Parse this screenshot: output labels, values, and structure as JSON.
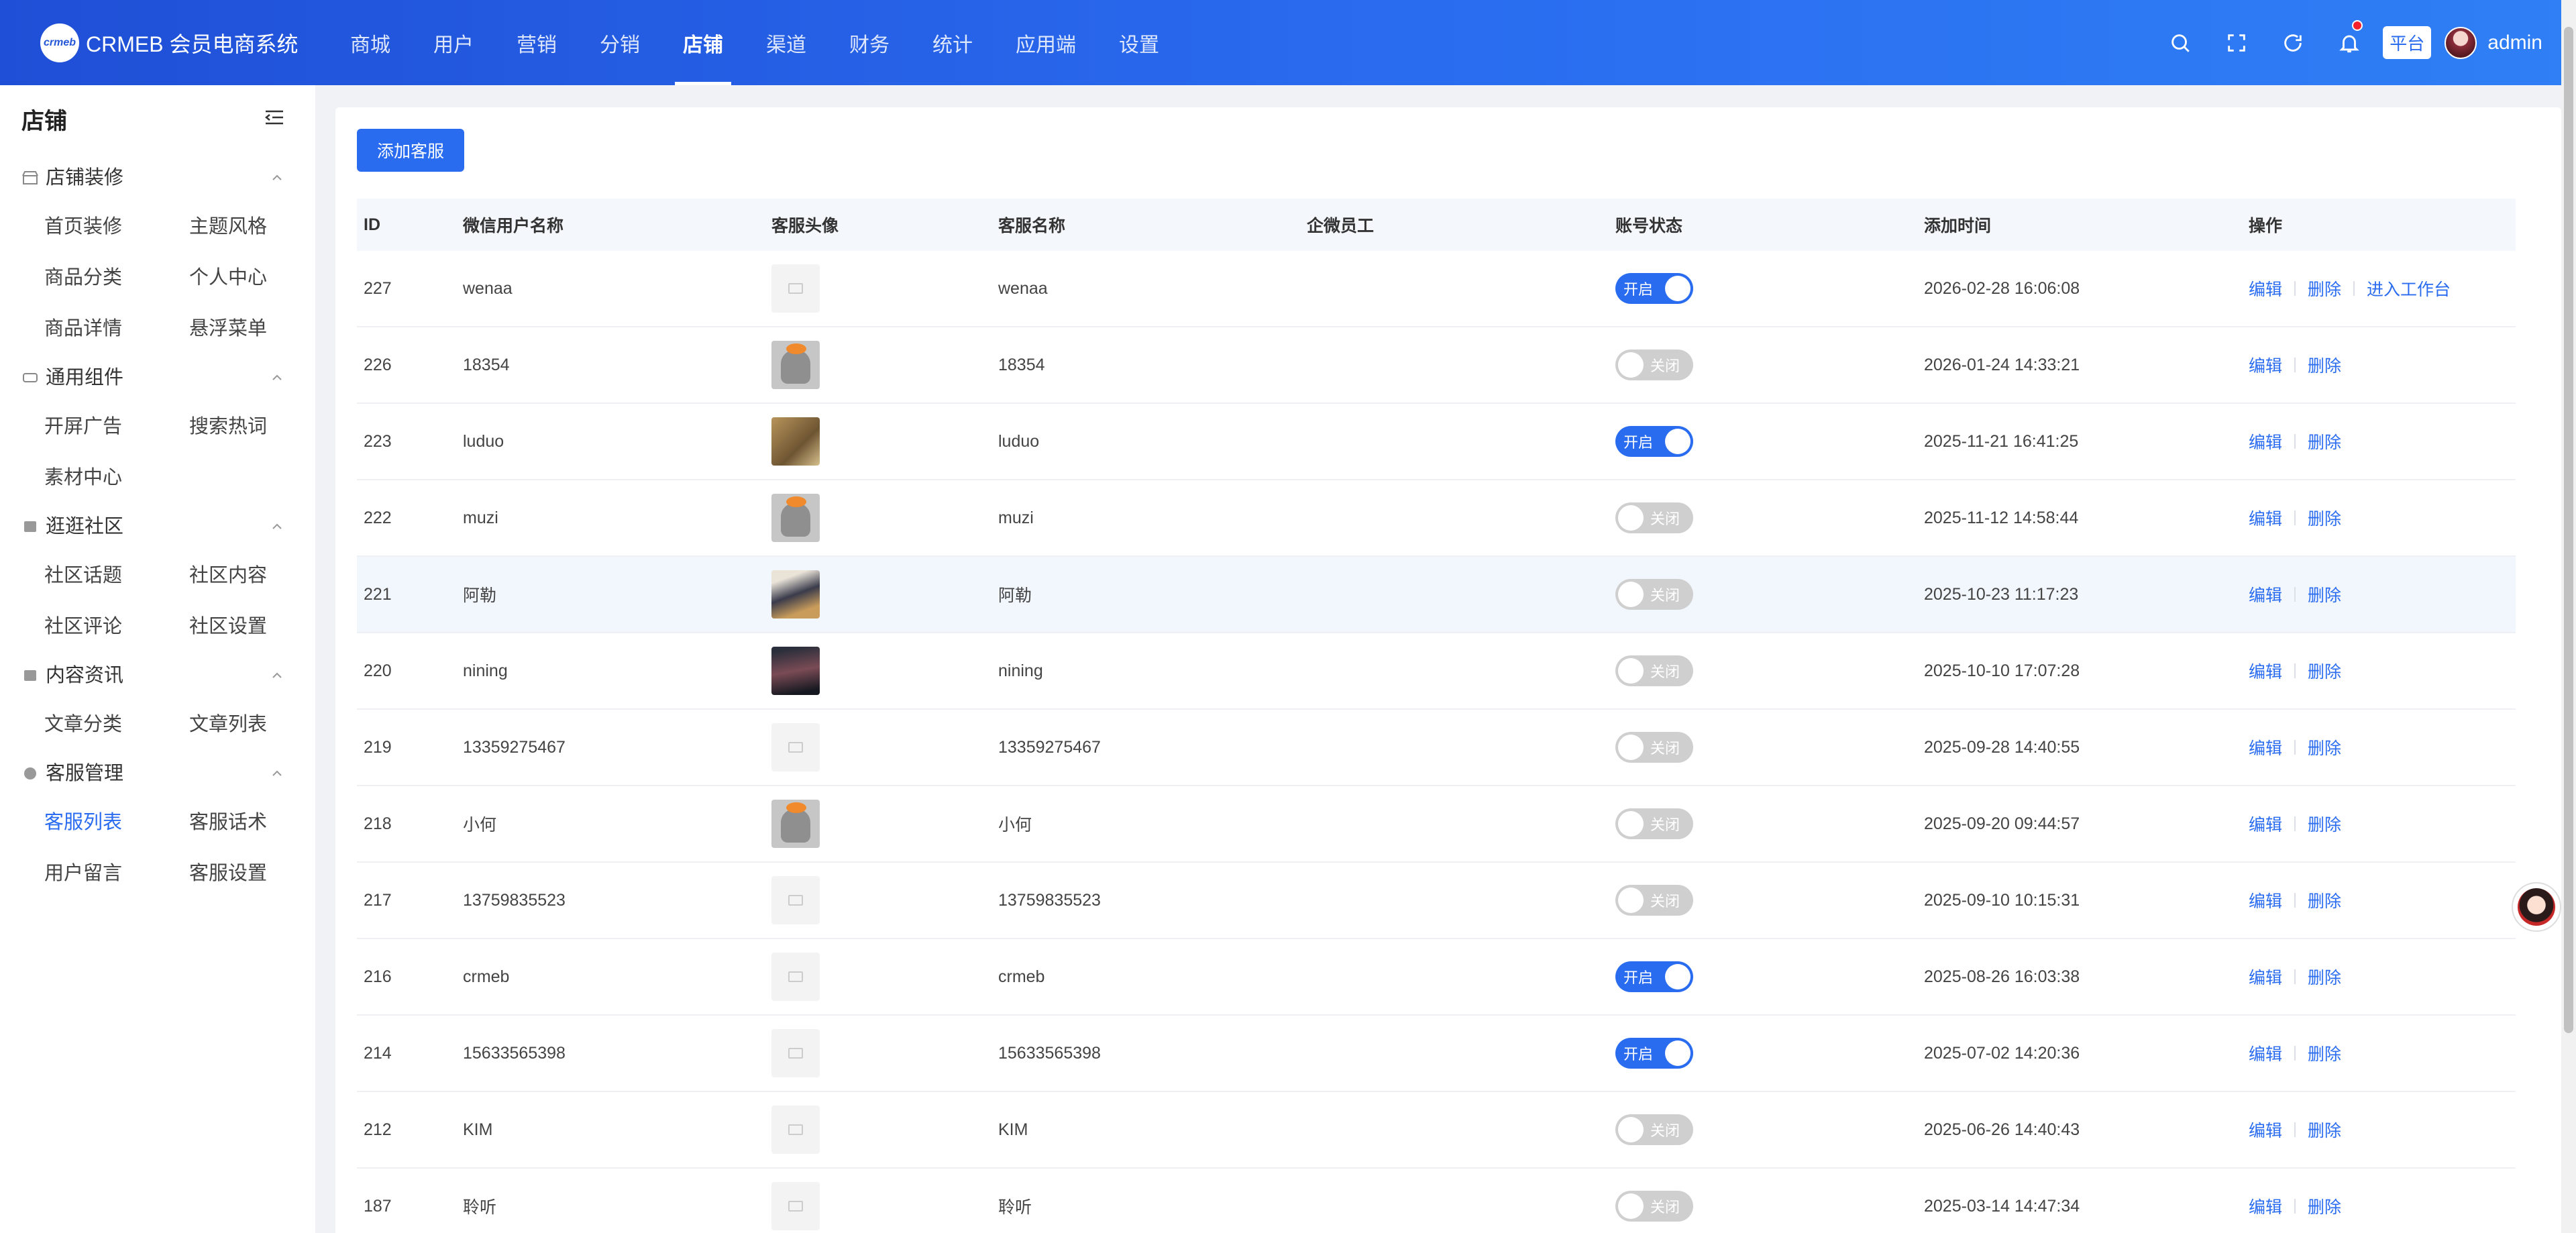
{
  "app": {
    "logo_mark": "crmeb",
    "title": "CRMEB 会员电商系统"
  },
  "topnav": [
    {
      "label": "商城",
      "active": false
    },
    {
      "label": "用户",
      "active": false
    },
    {
      "label": "营销",
      "active": false
    },
    {
      "label": "分销",
      "active": false
    },
    {
      "label": "店铺",
      "active": true
    },
    {
      "label": "渠道",
      "active": false
    },
    {
      "label": "财务",
      "active": false
    },
    {
      "label": "统计",
      "active": false
    },
    {
      "label": "应用端",
      "active": false
    },
    {
      "label": "设置",
      "active": false
    }
  ],
  "header_right": {
    "platform_tag": "平台",
    "username": "admin",
    "icons": [
      "search-icon",
      "fullscreen-icon",
      "refresh-icon",
      "bell-icon"
    ]
  },
  "sidebar": {
    "title": "店铺",
    "sections": [
      {
        "label": "店铺装修",
        "icon": "shop-icon",
        "items": [
          "首页装修",
          "主题风格",
          "商品分类",
          "个人中心",
          "商品详情",
          "悬浮菜单"
        ]
      },
      {
        "label": "通用组件",
        "icon": "component-icon",
        "items": [
          "开屏广告",
          "搜索热词",
          "素材中心"
        ]
      },
      {
        "label": "逛逛社区",
        "icon": "community-icon",
        "items": [
          "社区话题",
          "社区内容",
          "社区评论",
          "社区设置"
        ]
      },
      {
        "label": "内容资讯",
        "icon": "article-icon",
        "items": [
          "文章分类",
          "文章列表"
        ]
      },
      {
        "label": "客服管理",
        "icon": "service-icon",
        "items": [
          "客服列表",
          "客服话术",
          "用户留言",
          "客服设置"
        ]
      }
    ],
    "active_item": "客服列表"
  },
  "toolbar": {
    "add_label": "添加客服"
  },
  "table": {
    "headers": {
      "id": "ID",
      "nickname": "微信用户名称",
      "avatar": "客服头像",
      "name": "客服名称",
      "employee": "企微员工",
      "status": "账号状态",
      "time": "添加时间",
      "ops": "操作"
    },
    "status_on": "开启",
    "status_off": "关闭",
    "op_edit": "编辑",
    "op_delete": "删除",
    "op_workbench": "进入工作台",
    "rows": [
      {
        "id": "227",
        "nickname": "wenaa",
        "avatar": "default",
        "name": "wenaa",
        "employee": "",
        "status": "on",
        "time": "2026-02-28 16:06:08",
        "workbench": true
      },
      {
        "id": "226",
        "nickname": "18354",
        "avatar": "cat",
        "name": "18354",
        "employee": "",
        "status": "off",
        "time": "2026-01-24 14:33:21",
        "workbench": false
      },
      {
        "id": "223",
        "nickname": "luduo",
        "avatar": "brown",
        "name": "luduo",
        "employee": "",
        "status": "on",
        "time": "2025-11-21 16:41:25",
        "workbench": false
      },
      {
        "id": "222",
        "nickname": "muzi",
        "avatar": "cat",
        "name": "muzi",
        "employee": "",
        "status": "off",
        "time": "2025-11-12 14:58:44",
        "workbench": false
      },
      {
        "id": "221",
        "nickname": "阿勒",
        "avatar": "dark",
        "name": "阿勒",
        "employee": "",
        "status": "off",
        "time": "2025-10-23 11:17:23",
        "workbench": false
      },
      {
        "id": "220",
        "nickname": "nining",
        "avatar": "night",
        "name": "nining",
        "employee": "",
        "status": "off",
        "time": "2025-10-10 17:07:28",
        "workbench": false
      },
      {
        "id": "219",
        "nickname": "13359275467",
        "avatar": "default",
        "name": "13359275467",
        "employee": "",
        "status": "off",
        "time": "2025-09-28 14:40:55",
        "workbench": false
      },
      {
        "id": "218",
        "nickname": "小何",
        "avatar": "cat",
        "name": "小何",
        "employee": "",
        "status": "off",
        "time": "2025-09-20 09:44:57",
        "workbench": false
      },
      {
        "id": "217",
        "nickname": "13759835523",
        "avatar": "default",
        "name": "13759835523",
        "employee": "",
        "status": "off",
        "time": "2025-09-10 10:15:31",
        "workbench": false
      },
      {
        "id": "216",
        "nickname": "crmeb",
        "avatar": "default",
        "name": "crmeb",
        "employee": "",
        "status": "on",
        "time": "2025-08-26 16:03:38",
        "workbench": false
      },
      {
        "id": "214",
        "nickname": "15633565398",
        "avatar": "default",
        "name": "15633565398",
        "employee": "",
        "status": "on",
        "time": "2025-07-02 14:20:36",
        "workbench": false
      },
      {
        "id": "212",
        "nickname": "KIM",
        "avatar": "default",
        "name": "KIM",
        "employee": "",
        "status": "off",
        "time": "2025-06-26 14:40:43",
        "workbench": false
      },
      {
        "id": "187",
        "nickname": "聆听",
        "avatar": "default",
        "name": "聆听",
        "employee": "",
        "status": "off",
        "time": "2025-03-14 14:47:34",
        "workbench": false
      }
    ]
  },
  "colors": {
    "primary": "#2a6cf0",
    "header_start": "#1f4fd6",
    "switch_off": "#cfcfcf"
  }
}
